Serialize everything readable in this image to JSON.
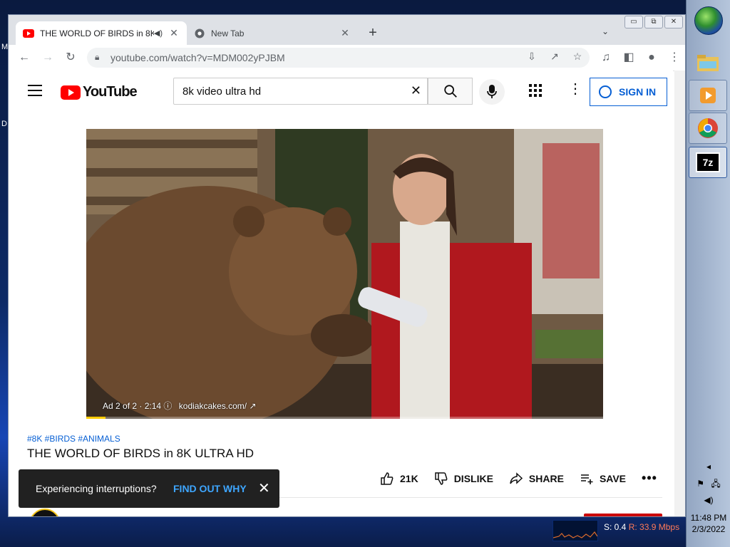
{
  "desktop": {
    "label_m": "M",
    "label_d": "D"
  },
  "browser": {
    "tabs": [
      {
        "title": "THE WORLD OF BIRDS in 8K",
        "active": true
      },
      {
        "title": "New Tab",
        "active": false
      }
    ],
    "new_tab_label": "+",
    "tab_search": "⌄",
    "window_controls": {
      "minimize": "▭",
      "restore": "⧉",
      "close": "✕"
    },
    "url": "youtube.com/watch?v=MDM002yPJBM"
  },
  "youtube": {
    "logo_text": "YouTube",
    "search_value": "8k video ultra hd",
    "signin_label": "SIGN IN",
    "video": {
      "ad_label": "Ad 2 of 2 · 2:14",
      "ad_site": "kodiakcakes.com/",
      "progress": 0.037
    },
    "tags": "#8K #BIRDS #ANIMALS",
    "title": "THE WORLD OF BIRDS in 8K ULTRA HD",
    "actions": {
      "like_count": "21K",
      "dislike": "DISLIKE",
      "share": "SHARE",
      "save": "SAVE"
    },
    "toast": {
      "message": "Experiencing interruptions?",
      "link": "FIND OUT WHY"
    }
  },
  "taskbar": {
    "clock_time": "11:48 PM",
    "clock_date": "2/3/2022",
    "net_s": "S: 0.4",
    "net_r": "R: 33.9 Mbps",
    "pinned": [
      "7z"
    ]
  },
  "colors": {
    "accent": "#065fd4",
    "youtube_red": "#ff0000",
    "toast_link": "#3ea6ff"
  }
}
